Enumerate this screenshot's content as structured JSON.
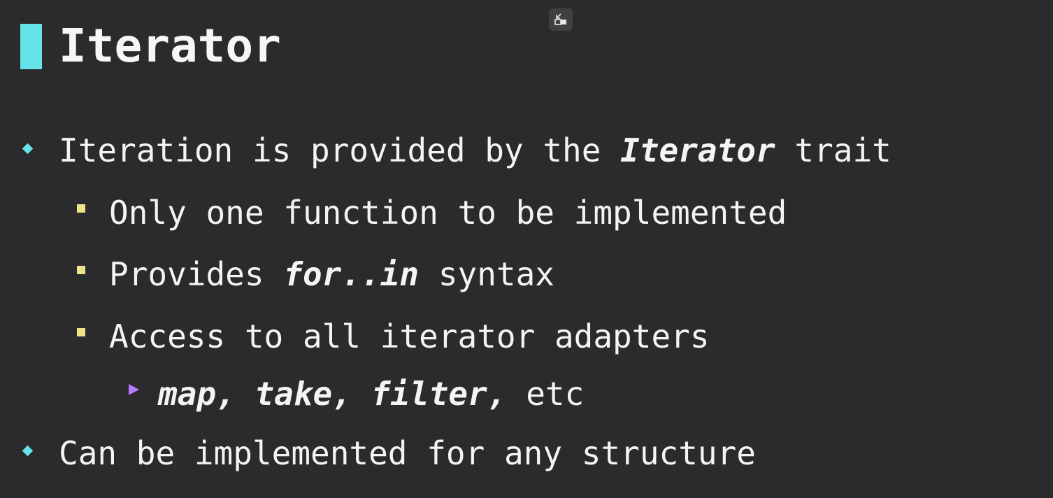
{
  "slide": {
    "title": "Iterator",
    "points": [
      {
        "level": 1,
        "segments": [
          {
            "text": "Iteration is provided by the ",
            "emphasis": false
          },
          {
            "text": "Iterator",
            "emphasis": true
          },
          {
            "text": " trait",
            "emphasis": false
          }
        ]
      },
      {
        "level": 2,
        "segments": [
          {
            "text": "Only one function to be implemented",
            "emphasis": false
          }
        ]
      },
      {
        "level": 2,
        "segments": [
          {
            "text": "Provides ",
            "emphasis": false
          },
          {
            "text": "for..in",
            "emphasis": true
          },
          {
            "text": " syntax",
            "emphasis": false
          }
        ]
      },
      {
        "level": 2,
        "segments": [
          {
            "text": "Access to all iterator adapters",
            "emphasis": false
          }
        ]
      },
      {
        "level": 3,
        "segments": [
          {
            "text": "map, take, filter,",
            "emphasis": true
          },
          {
            "text": " etc",
            "emphasis": false
          }
        ]
      },
      {
        "level": 1,
        "segments": [
          {
            "text": "Can be implemented for any structure",
            "emphasis": false
          }
        ]
      }
    ]
  },
  "colors": {
    "background": "#2b2a2c",
    "accent_level1": "#66e3e8",
    "accent_level2": "#efe48a",
    "accent_level3": "#b57cff",
    "text": "#f4f4f4"
  },
  "icons": {
    "toggle": "restore-window-icon"
  }
}
